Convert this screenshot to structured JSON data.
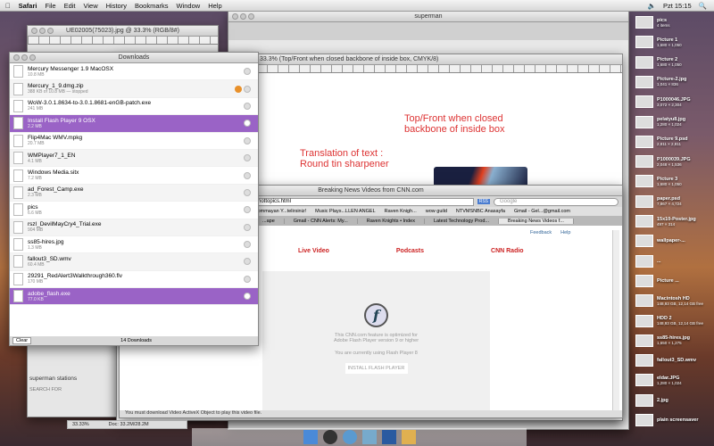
{
  "menubar": {
    "app": "Safari",
    "items": [
      "File",
      "Edit",
      "View",
      "History",
      "Bookmarks",
      "Window",
      "Help"
    ],
    "clock": "Pzt 15:15"
  },
  "finder": {
    "title": "superman",
    "sidebar_item": "superman stations",
    "search_for": "SEARCH FOR"
  },
  "ps1": {
    "title": "UE02005(75023).jpg @ 33.3% (RGB/8#)",
    "zoom": "33.33%",
    "doc": "Doc: 33.2M/28.2M"
  },
  "ps2": {
    "title": "33.3% (Top/Front when closed backbone of inside box, CMYK/8)",
    "annot1": [
      "Top/Front when closed",
      "backbone of inside box"
    ],
    "annot2": [
      "Translation of text :",
      "Round tin sharpener"
    ]
  },
  "downloads": {
    "title": "Downloads",
    "clear": "Clear",
    "count": "14 Downloads",
    "items": [
      {
        "name": "Mercury Messenger 1.9 MacOSX",
        "size": "10.8 MB"
      },
      {
        "name": "Mercury_1_9.dmg.zip",
        "size": "388 KB of 10.8 MB — stopped",
        "stopped": true
      },
      {
        "name": "WoW-3.0.1.8634-to-3.0.1.8681-enGB-patch.exe",
        "size": "241 MB"
      },
      {
        "name": "Install Flash Player 9 OSX",
        "size": "2.2 MB",
        "selected": true
      },
      {
        "name": "Flip4Mac WMV.mpkg",
        "size": "20.7 MB"
      },
      {
        "name": "WMPlayer7_1_EN",
        "size": "4.1 MB"
      },
      {
        "name": "Windows Media.sitx",
        "size": "7.2 MB"
      },
      {
        "name": "ad_Forest_Camp.exe",
        "size": "2.3 MB"
      },
      {
        "name": "pics",
        "size": "6.6 MB"
      },
      {
        "name": "rszl_DevilMayCry4_Trial.exe",
        "size": "904 MB"
      },
      {
        "name": "ss85-hires.jpg",
        "size": "1.3 MB"
      },
      {
        "name": "fallout3_SD.wmv",
        "size": "60.4 MB"
      },
      {
        "name": "29291_RedAlert3Walkthrough360.flv",
        "size": "170 MB"
      },
      {
        "name": "adobe_flash.exe",
        "size": "77.0 KB",
        "selected": true
      }
    ]
  },
  "safari": {
    "title": "Breaking News Videos from CNN.com",
    "url": "hottopics.html",
    "search_placeholder": "Google",
    "rss": "RSS",
    "bookmarks": [
      "...ommayan Y...telirsiniz!",
      "Music Plays...LLEN ANGEL",
      "Raven Knigh...",
      "wow guild",
      "NTVMSNBC Anasayfa",
      "Gmail - Gel...@gmail.com"
    ],
    "tabs": [
      "...ape",
      "Gmail - CNN Alerts: My...",
      "Raven Knights • Index",
      "Latest Technology Prod...",
      "Breaking News Videos f..."
    ],
    "feedback": "Feedback",
    "help": "Help",
    "nav": [
      "Live Video",
      "Podcasts",
      "CNN Radio"
    ],
    "flash_msg1": "This CNN.com feature is optimized for Adobe Flash Player version 9 or higher",
    "flash_msg2": "You are currently using Flash Player 8",
    "install": "INSTALL FLASH PLAYER",
    "status": "You must download Video ActiveX Object to play this video file."
  },
  "desktop": [
    {
      "name": "pics",
      "dim": "4 items"
    },
    {
      "name": "Picture 1",
      "dim": "1,680 × 1,050"
    },
    {
      "name": "Picture 2",
      "dim": "1,680 × 1,050"
    },
    {
      "name": "Picture-2.jpg",
      "dim": "1,041 × 836"
    },
    {
      "name": "P1000046.JPG",
      "dim": "3,072 × 2,304"
    },
    {
      "name": "pelatyu8.jpg",
      "dim": "1,280 × 1,024"
    },
    {
      "name": "Picture 9.psd",
      "dim": "2,811 × 2,811"
    },
    {
      "name": "P1000039.JPG",
      "dim": "2,048 × 1,536"
    },
    {
      "name": "Picture 3",
      "dim": "1,680 × 1,050"
    },
    {
      "name": "paper.psd",
      "dim": "7,867 × 4,724"
    },
    {
      "name": "15x10-Poster.jpg",
      "dim": "497 × 314"
    },
    {
      "name": "wallpaper-...",
      "dim": ""
    },
    {
      "name": "...",
      "dim": ""
    },
    {
      "name": "Picture ...",
      "dim": ""
    },
    {
      "name": "Macintosh HD",
      "dim": "148,93 GB, 12,14 GB free"
    },
    {
      "name": "HDD 2",
      "dim": "148,93 GB, 12,14 GB free"
    },
    {
      "name": "ss85-hires.jpg",
      "dim": "1,650 × 1,275"
    },
    {
      "name": "fallout3_SD.wmv",
      "dim": ""
    },
    {
      "name": "eldar.JPG",
      "dim": "1,280 × 1,024"
    },
    {
      "name": "2.jpg",
      "dim": ""
    },
    {
      "name": "plain screensaver",
      "dim": ""
    }
  ]
}
